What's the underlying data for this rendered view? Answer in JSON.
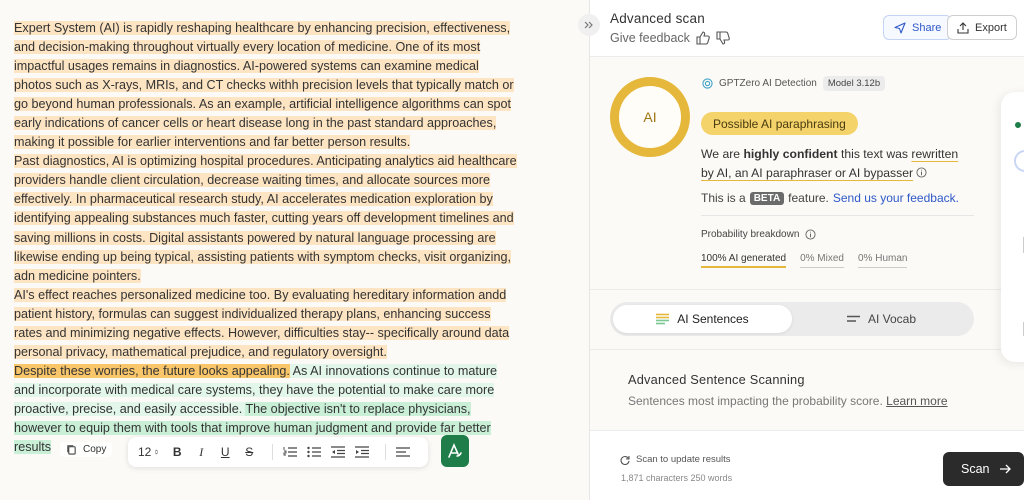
{
  "editor": {
    "paragraphs": [
      {
        "segments": [
          {
            "text": "Expert System (AI) is rapidly reshaping healthcare by enhancing precision, effectiveness, and decision-making throughout virtually every location of medicine. One of its most impactful usages remains in diagnostics. AI-powered systems can examine medical photos such as X-rays, MRIs, and CT checks withh precision levels that typically match or go beyond human professionals. As an example, artificial intelligence algorithms can spot early indications of cancer cells or heart disease long in the past standard approaches, making it possible for earlier interventions and far better person results.",
            "hl": "or"
          }
        ]
      },
      {
        "segments": [
          {
            "text": "Past diagnostics, AI is optimizing hospital procedures. Anticipating analytics aid healthcare providers handle client circulation, decrease waiting times, and allocate sources more effectively. In pharmaceutical research study, AI accelerates medication exploration by identifying appealing substances much faster, cutting years off development timelines and saving millions in costs. Digital assistants powered by natural language processing are likewise ending up being typical, assisting patients with symptom checks, visit organizing, adn medicine pointers.",
            "hl": "or"
          }
        ]
      },
      {
        "segments": [
          {
            "text": "AI's effect reaches personalized medicine too. By evaluating hereditary information andd patient history, formulas can suggest individualized therapy plans, enhancing success rates and minimizing negative effects. However, difficulties stay-- specifically around data personal privacy, mathematical prejudice, and regulatory oversight.",
            "hl": "or"
          }
        ]
      },
      {
        "segments": [
          {
            "text": "Despite these worries, the future looks appealing.",
            "hl": "or-strong"
          },
          {
            "text": " As AI innovations continue to mature and incorporate with medical care systems, they have the potential to make care more proactive, precise, and easily accessible. ",
            "hl": "gr-light"
          },
          {
            "text": "The objective isn't to replace physicians, however to equip them with tools that improve human judgment and provide far better results",
            "hl": "gr"
          }
        ]
      }
    ],
    "copy_label": "Copy",
    "font_size": "12",
    "toolbar_icons": [
      "bold-icon",
      "italic-icon",
      "underline-icon",
      "strikethrough-icon",
      "ordered-list-icon",
      "bullet-list-icon",
      "outdent-icon",
      "indent-icon",
      "align-icon"
    ],
    "toolbar_glyphs": {
      "bold": "B",
      "italic": "I",
      "underline": "U",
      "strike": "S"
    }
  },
  "panel": {
    "title": "Advanced scan",
    "feedback_label": "Give feedback",
    "share_label": "Share",
    "export_label": "Export",
    "detector_name": "GPTZero AI Detection",
    "model_badge": "Model 3.12b",
    "ring_label": "AI",
    "verdict": "Possible AI paraphrasing",
    "confidence": {
      "prefix": "We are ",
      "bold": "highly confident",
      "middle": " this text was ",
      "underlined": "rewritten by AI, an AI paraphraser or AI bypasser"
    },
    "beta_prefix": "This is a",
    "beta_badge": "BETA",
    "beta_suffix": "feature.",
    "beta_link": "Send us your feedback.",
    "prob_label": "Probability breakdown",
    "prob_values": [
      "100% AI generated",
      "0% Mixed",
      "0% Human"
    ],
    "tabs": [
      {
        "label": "AI Sentences",
        "icon": "sentences-icon",
        "active": true
      },
      {
        "label": "AI Vocab",
        "icon": "vocab-icon",
        "active": false
      }
    ],
    "scan_title": "Advanced Sentence Scanning",
    "scan_sub": "Sentences most impacting the probability score.",
    "scan_learn_more": "Learn more",
    "update_label": "Scan to update results",
    "counts": "1,871 characters 250 words",
    "scan_button": "Scan"
  },
  "colors": {
    "highlight_orange": "#fde4c2",
    "highlight_orange_strong": "#f9c66a",
    "highlight_green": "#c9f0d7",
    "ai_yellow": "#e5b73b",
    "link_blue": "#2f59c8",
    "brand_green": "#1e7d49"
  }
}
